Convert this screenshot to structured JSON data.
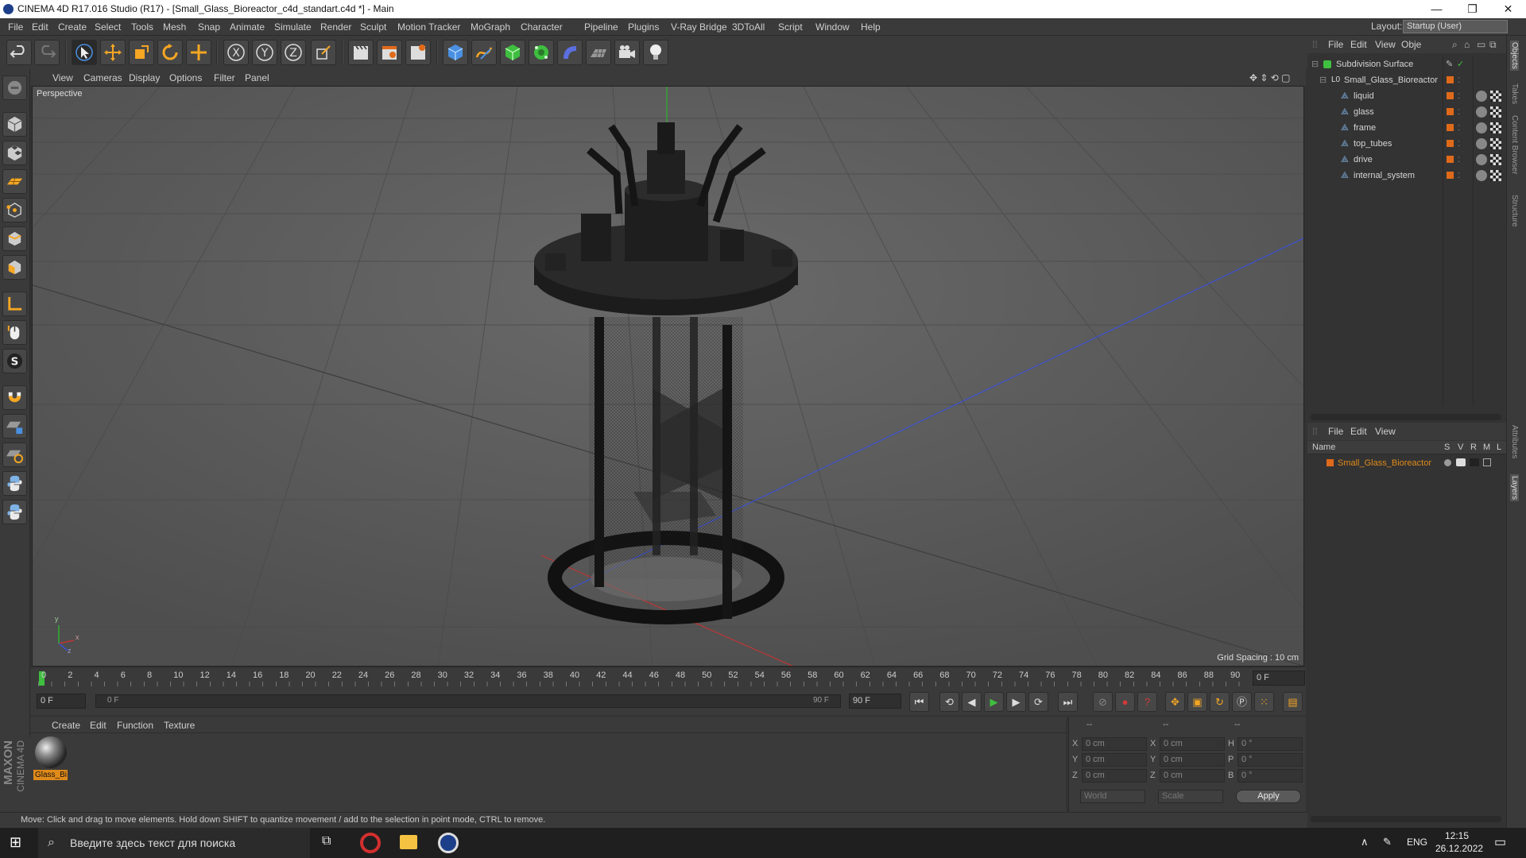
{
  "window": {
    "title": "CINEMA 4D R17.016 Studio (R17) - [Small_Glass_Bioreactor_c4d_standart.c4d *] - Main",
    "minimize": "—",
    "maximize": "❐",
    "close": "✕"
  },
  "menubar": {
    "items": [
      "File",
      "Edit",
      "Create",
      "Select",
      "Tools",
      "Mesh",
      "Snap",
      "Animate",
      "Simulate",
      "Render",
      "Sculpt",
      "Motion Tracker",
      "MoGraph",
      "Character",
      "Pipeline",
      "Plugins",
      "V-Ray Bridge",
      "3DToAll",
      "Script",
      "Window",
      "Help"
    ],
    "layout_label": "Layout:",
    "layout_value": "Startup (User)"
  },
  "viewport": {
    "menu": [
      "View",
      "Cameras",
      "Display",
      "Options",
      "Filter",
      "Panel"
    ],
    "label": "Perspective",
    "grid_spacing": "Grid Spacing : 10 cm",
    "axis_y": "y",
    "axis_x": "x",
    "axis_z": "z"
  },
  "timeline": {
    "ticks": [
      "0",
      "2",
      "4",
      "6",
      "8",
      "10",
      "12",
      "14",
      "16",
      "18",
      "20",
      "22",
      "24",
      "26",
      "28",
      "30",
      "32",
      "34",
      "36",
      "38",
      "40",
      "42",
      "44",
      "46",
      "48",
      "50",
      "52",
      "54",
      "56",
      "58",
      "60",
      "62",
      "64",
      "66",
      "68",
      "70",
      "72",
      "74",
      "76",
      "78",
      "80",
      "82",
      "84",
      "86",
      "88",
      "90"
    ],
    "current_frame": "0 F"
  },
  "transport": {
    "start_field": "0 F",
    "range_start": "0 F",
    "range_end": "90 F",
    "end_field": "90 F"
  },
  "materials": {
    "menu": [
      "Create",
      "Edit",
      "Function",
      "Texture"
    ],
    "items": [
      {
        "label": "Glass_Bi"
      }
    ],
    "brand_line1": "MAXON",
    "brand_line2": "CINEMA 4D"
  },
  "coordinates": {
    "header": [
      "--",
      "--",
      "--"
    ],
    "rows": [
      {
        "a": "X",
        "av": "0 cm",
        "b": "X",
        "bv": "0 cm",
        "c": "H",
        "cv": "0 °"
      },
      {
        "a": "Y",
        "av": "0 cm",
        "b": "Y",
        "bv": "0 cm",
        "c": "P",
        "cv": "0 °"
      },
      {
        "a": "Z",
        "av": "0 cm",
        "b": "Z",
        "bv": "0 cm",
        "c": "B",
        "cv": "0 °"
      }
    ],
    "space": "World",
    "mode": "Scale",
    "apply": "Apply"
  },
  "status": {
    "text": "Move: Click and drag to move elements. Hold down SHIFT to quantize movement / add to the selection in point mode, CTRL to remove."
  },
  "objects": {
    "menu": [
      "File",
      "Edit",
      "View",
      "Obje"
    ],
    "items": [
      {
        "name": "Subdivision Surface",
        "level": 0
      },
      {
        "name": "Small_Glass_Bioreactor",
        "level": 1
      },
      {
        "name": "liquid",
        "level": 2
      },
      {
        "name": "glass",
        "level": 2
      },
      {
        "name": "frame",
        "level": 2
      },
      {
        "name": "top_tubes",
        "level": 2
      },
      {
        "name": "drive",
        "level": 2
      },
      {
        "name": "internal_system",
        "level": 2
      }
    ]
  },
  "layers": {
    "menu": [
      "File",
      "Edit",
      "View"
    ],
    "headers": [
      "Name",
      "S",
      "V",
      "R",
      "M",
      "L"
    ],
    "items": [
      {
        "name": "Small_Glass_Bioreactor",
        "color": "#e06a1a"
      }
    ]
  },
  "sidetabs": [
    "Objects",
    "Takes",
    "Content Browser",
    "Structure",
    "Attributes",
    "Layers"
  ],
  "taskbar": {
    "search_placeholder": "Введите здесь текст для поиска",
    "lang": "ENG",
    "time": "12:15",
    "date": "26.12.2022"
  },
  "colors": {
    "accent_orange": "#e06a1a",
    "play_green": "#3fbf3f",
    "record_red": "#d23a3a",
    "axis_green": "#2fae2f",
    "axis_blue": "#3c52d0",
    "axis_red": "#c03535"
  }
}
